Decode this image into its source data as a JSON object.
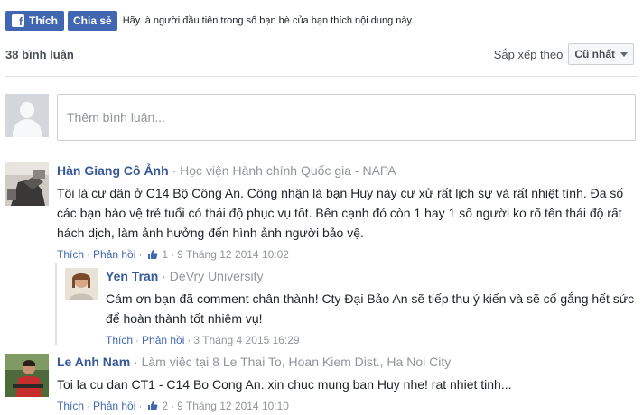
{
  "top": {
    "like_label": "Thích",
    "share_label": "Chia sẻ",
    "social_text": "Hãy là người đầu tiên trong số bạn bè của bạn thích nội dung này."
  },
  "header": {
    "count": "38 bình luận",
    "sort_label": "Sắp xếp theo",
    "sort_value": "Cũ nhất"
  },
  "composer": {
    "placeholder": "Thêm bình luận..."
  },
  "comments": [
    {
      "author": "Hàn Giang Cô Ảnh",
      "affiliation": "· Học viện Hành chính Quốc gia - NAPA",
      "text": "Tôi là cư dân ở C14 Bộ Công An. Công nhận là bạn Huy này cư xử rất lịch sự và rất nhiệt tình. Đa số các bạn bảo vệ trẻ tuổi có thái độ phục vụ tốt. Bên cạnh đó còn 1 hay 1 số người ko rõ tên thái độ rất hách dịch, làm ảnh hưởng đến hình ảnh người bảo vệ.",
      "like": "Thích",
      "reply": "Phản hồi",
      "likes": "1",
      "time": "9 Tháng 12 2014 10:02"
    },
    {
      "author": "Yen Tran",
      "affiliation": "· DeVry University",
      "text": "Cám ơn bạn đã comment chân thành! Cty Đại Bảo An sẽ tiếp thu ý kiến và sẽ cố gắng hết sức để hoàn thành tốt nhiệm vụ!",
      "like": "Thích",
      "reply": "Phản hồi",
      "time": "3 Tháng 4 2015 16:29"
    },
    {
      "author": "Le Anh Nam",
      "affiliation": "· Làm việc tại 8 Le Thai To, Hoan Kiem Dist., Ha Noi City",
      "text": "Toi la cu dan CT1 - C14 Bo Cong An. xin chuc mung ban Huy nhe! rat nhiet tinh...",
      "like": "Thích",
      "reply": "Phản hồi",
      "likes": "2",
      "time": "9 Tháng 12 2014 10:10"
    }
  ]
}
